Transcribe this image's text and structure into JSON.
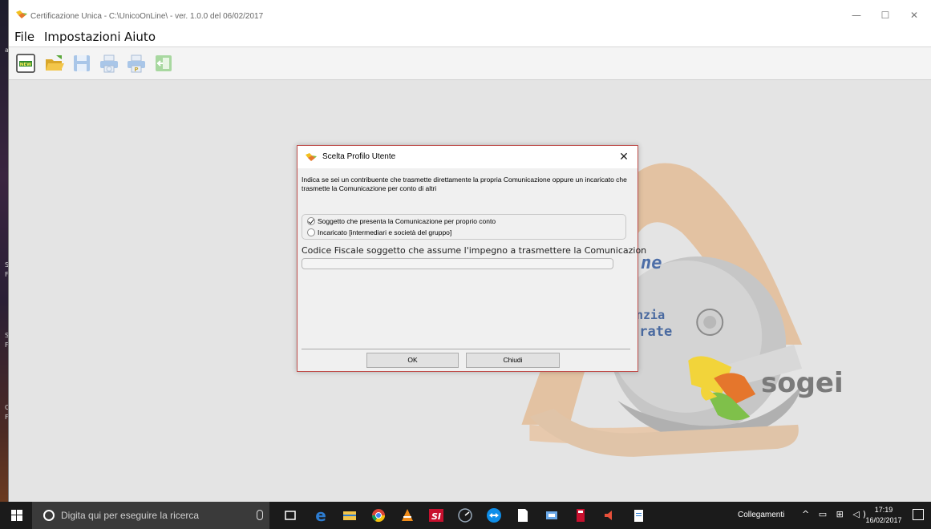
{
  "window": {
    "title": "Certificazione Unica - C:\\UnicoOnLine\\ - ver. 1.0.0 del 06/02/2017",
    "minimize": "—",
    "maximize": "☐",
    "close": "✕"
  },
  "menu": {
    "items": [
      "File",
      "Impostazioni",
      "Aiuto"
    ]
  },
  "desktop_strip": [
    "a",
    "S",
    "F",
    "S",
    "F",
    "C",
    "F"
  ],
  "toolbar": {
    "new_label": "NEW"
  },
  "background_logo": {
    "text_ne": "ne",
    "text_agenzia": "nzia",
    "text_entrate": "trate",
    "text_sogei": "sogei"
  },
  "dialog": {
    "title": "Scelta Profilo Utente",
    "close": "✕",
    "description": "Indica se sei un contribuente che trasmette direttamente la propria Comunicazione oppure un incaricato che trasmette la Comunicazione per conto di altri",
    "options": [
      {
        "label": "Soggetto che presenta la Comunicazione per proprio conto",
        "checked": true
      },
      {
        "label": "Incaricato [intermediari e società del gruppo]",
        "checked": false
      }
    ],
    "cf_label": "Codice Fiscale soggetto che assume l'impegno a trasmettere la Comunicazion",
    "cf_value": "",
    "ok_label": "OK",
    "close_label": "Chiudi"
  },
  "taskbar": {
    "search_placeholder": "Digita qui per eseguire la ricerca",
    "tray_label": "Collegamenti",
    "tray_icons": "^ ▭ ⊞ ◁)",
    "time": "17:19",
    "date": "16/02/2017"
  },
  "colors": {
    "dialog_border": "#c0504d",
    "logo_blue": "#4a6aa0",
    "sogei_grey": "#7a7a7a"
  }
}
